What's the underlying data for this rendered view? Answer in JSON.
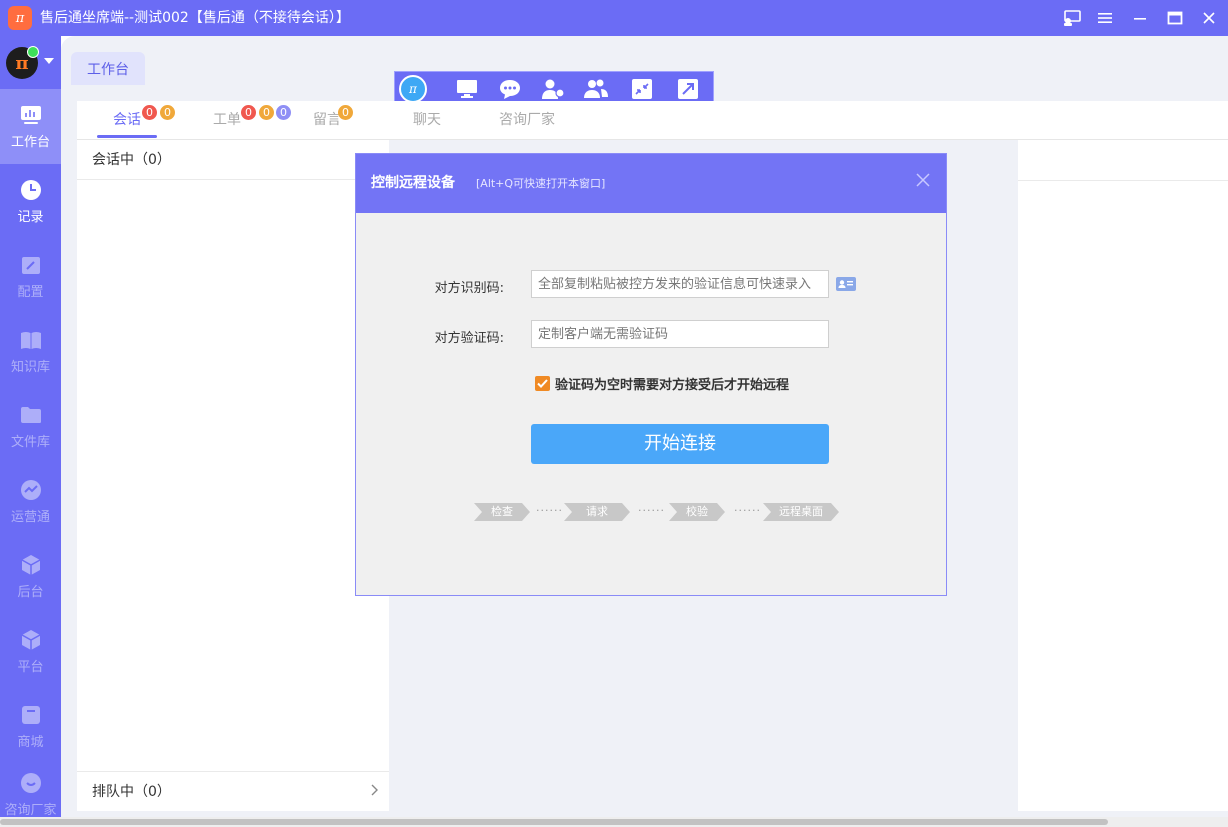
{
  "window": {
    "title": "售后通坐席端--测试002【售后通（不接待会话）】",
    "logo_text": "π"
  },
  "sidebar": {
    "avatar_text": "π",
    "items": [
      {
        "label": "工作台",
        "icon": "dashboard-icon"
      },
      {
        "label": "记录",
        "icon": "clock-icon"
      },
      {
        "label": "配置",
        "icon": "config-icon"
      },
      {
        "label": "知识库",
        "icon": "book-icon"
      },
      {
        "label": "文件库",
        "icon": "folder-icon"
      },
      {
        "label": "运营通",
        "icon": "chart-icon"
      },
      {
        "label": "后台",
        "icon": "cube-icon"
      },
      {
        "label": "平台",
        "icon": "cube-icon"
      },
      {
        "label": "商城",
        "icon": "box-icon"
      },
      {
        "label": "咨询厂家",
        "icon": "smile-icon"
      }
    ]
  },
  "workspace_tab": "工作台",
  "tabs": [
    {
      "label": "会话",
      "badges": [
        "0",
        "0"
      ]
    },
    {
      "label": "工单",
      "badges": [
        "0",
        "0",
        "0"
      ]
    },
    {
      "label": "留言",
      "badges": [
        "0"
      ]
    },
    {
      "label": "聊天",
      "badges": []
    },
    {
      "label": "咨询厂家",
      "badges": []
    }
  ],
  "colors": {
    "accent": "#6b6cf5",
    "badge_red": "#f0584f",
    "badge_orange": "#f0a83a",
    "badge_purple": "#8f8ff5",
    "button_blue": "#4aa7f9",
    "check_orange": "#f08a24"
  },
  "left_panel": {
    "in_session": "会话中（0）",
    "queue": "排队中（0）"
  },
  "dialog": {
    "title": "控制远程设备",
    "hint": "[Alt+Q可快速打开本窗口]",
    "id_label": "对方识别码:",
    "id_placeholder": "全部复制粘贴被控方发来的验证信息可快速录入",
    "code_label": "对方验证码:",
    "code_placeholder": "定制客户端无需验证码",
    "checkbox_label": "验证码为空时需要对方接受后才开始远程",
    "checkbox_checked": true,
    "connect_button": "开始连接",
    "steps": [
      "检查",
      "请求",
      "校验",
      "远程桌面"
    ],
    "step_dots": "······"
  }
}
